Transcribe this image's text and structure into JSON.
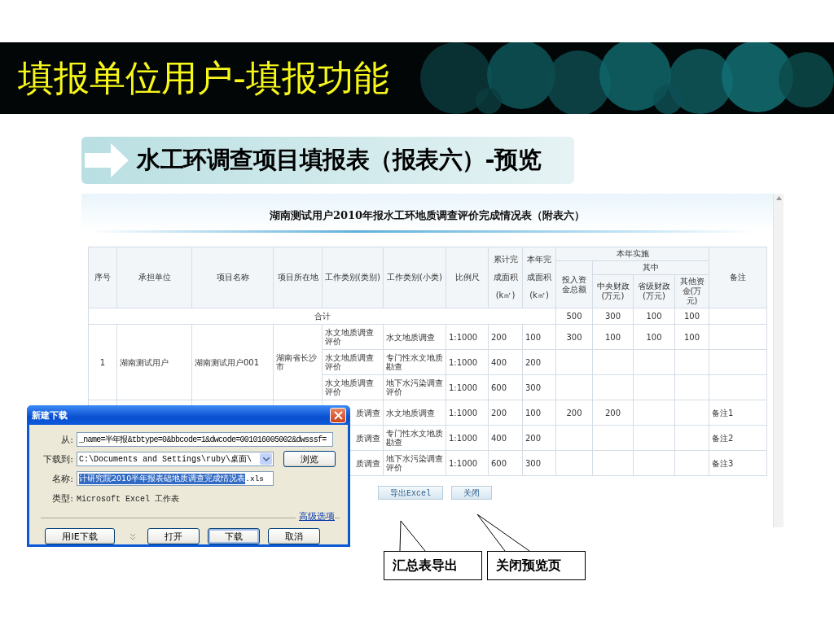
{
  "slide": {
    "title": "填报单位用户-填报功能",
    "subtitle": "水工环调查项目填报表（报表六）-预览"
  },
  "report": {
    "title": "湖南测试用户2010年报水工环地质调查评价完成情况表（附表六）",
    "columns": [
      {
        "label": "序号"
      },
      {
        "label": "承担单位"
      },
      {
        "label": "项目名称"
      },
      {
        "label": "项目所在地"
      },
      {
        "label": "工作类别(类别)"
      },
      {
        "label": "工作类别(小类)"
      },
      {
        "label": "比例尺"
      },
      {
        "label": "累计完成面积(k㎡)"
      },
      {
        "label": "本年完成面积(k㎡)"
      },
      {
        "label": "本年实施",
        "children": [
          {
            "label": "投入资金总额"
          },
          {
            "label": "其中",
            "children": [
              {
                "label": "中央财政(万元)"
              },
              {
                "label": "省级财政(万元)"
              },
              {
                "label": "其他资金(万元)"
              }
            ]
          }
        ]
      },
      {
        "label": "备注"
      }
    ],
    "total": {
      "label": "合计",
      "values": [
        "500",
        "300",
        "100",
        "100"
      ]
    },
    "groups": [
      {
        "covered": false,
        "no": "1",
        "unit": "湖南测试用户",
        "project": "湖南测试用户001",
        "location": "湖南省长沙市",
        "items": [
          {
            "category": "水文地质调查评价",
            "subcategory": "水文地质调查",
            "scale": "1:1000",
            "cumulative": "200",
            "this_year": "100",
            "investment": "300",
            "central": "100",
            "provincial": "100",
            "other": "100"
          },
          {
            "category": "水文地质调查评价",
            "subcategory": "专门性水文地质勘查",
            "scale": "1:1000",
            "cumulative": "400",
            "this_year": "200"
          },
          {
            "category": "水文地质调查评价",
            "subcategory": "地下水污染调查评价",
            "scale": "1:1000",
            "cumulative": "600",
            "this_year": "300"
          }
        ]
      },
      {
        "covered": true,
        "items": [
          {
            "category": "质调查",
            "subcategory": "水文地质调查",
            "scale": "1:1000",
            "cumulative": "200",
            "this_year": "100",
            "investment": "200",
            "central": "200",
            "remark": "备注1"
          },
          {
            "category": "质调查",
            "subcategory": "专门性水文地质勘查",
            "scale": "1:1000",
            "cumulative": "400",
            "this_year": "200",
            "remark": "备注2"
          },
          {
            "category": "质调查",
            "subcategory": "地下水污染调查评价",
            "scale": "1:1000",
            "cumulative": "600",
            "this_year": "300",
            "remark": "备注3"
          }
        ]
      }
    ],
    "buttons": [
      "导出Excel",
      "关闭"
    ]
  },
  "callouts": [
    "汇总表导出",
    "关闭预览页"
  ],
  "dialog": {
    "title": "新建下载",
    "from_label": "从:",
    "from_value": "_name=半年报&tbtype=0&bbcode=1&dwcode=001016005002&dwsssf=",
    "save_label": "下载到:",
    "save_value": "C:\\Documents and Settings\\ruby\\桌面\\",
    "browse": "浏览",
    "name_label": "名称:",
    "name_selected": "计研究院2010半年报表础地质调查完成情况表",
    "name_suffix": ".xls",
    "type_label": "类型:",
    "type_value": "Microsoft Excel 工作表",
    "advanced": "高级选项",
    "buttons": [
      {
        "label": "用IE下载",
        "default": false
      },
      {
        "label": "打开",
        "default": false
      },
      {
        "label": "下载",
        "default": true
      },
      {
        "label": "取消",
        "default": false
      }
    ]
  }
}
